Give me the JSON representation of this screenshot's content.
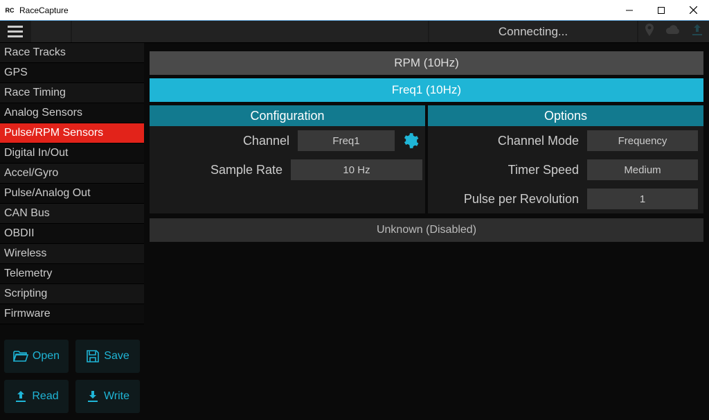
{
  "window": {
    "title": "RaceCapture",
    "icon_text": "RC"
  },
  "toolbar": {
    "status": "Connecting..."
  },
  "sidebar": {
    "items": [
      "Race Tracks",
      "GPS",
      "Race Timing",
      "Analog Sensors",
      "Pulse/RPM Sensors",
      "Digital In/Out",
      "Accel/Gyro",
      "Pulse/Analog Out",
      "CAN Bus",
      "OBDII",
      "Wireless",
      "Telemetry",
      "Scripting",
      "Firmware"
    ],
    "active_index": 4,
    "buttons": {
      "open": "Open",
      "save": "Save",
      "read": "Read",
      "write": "Write"
    }
  },
  "content": {
    "tabs": [
      {
        "label": "RPM (10Hz)",
        "active": false
      },
      {
        "label": "Freq1 (10Hz)",
        "active": true
      }
    ],
    "configuration": {
      "title": "Configuration",
      "channel_label": "Channel",
      "channel_value": "Freq1",
      "sample_rate_label": "Sample Rate",
      "sample_rate_value": "10 Hz"
    },
    "options": {
      "title": "Options",
      "channel_mode_label": "Channel Mode",
      "channel_mode_value": "Frequency",
      "timer_speed_label": "Timer Speed",
      "timer_speed_value": "Medium",
      "ppr_label": "Pulse per Revolution",
      "ppr_value": "1"
    },
    "disabled_row": "Unknown (Disabled)"
  }
}
